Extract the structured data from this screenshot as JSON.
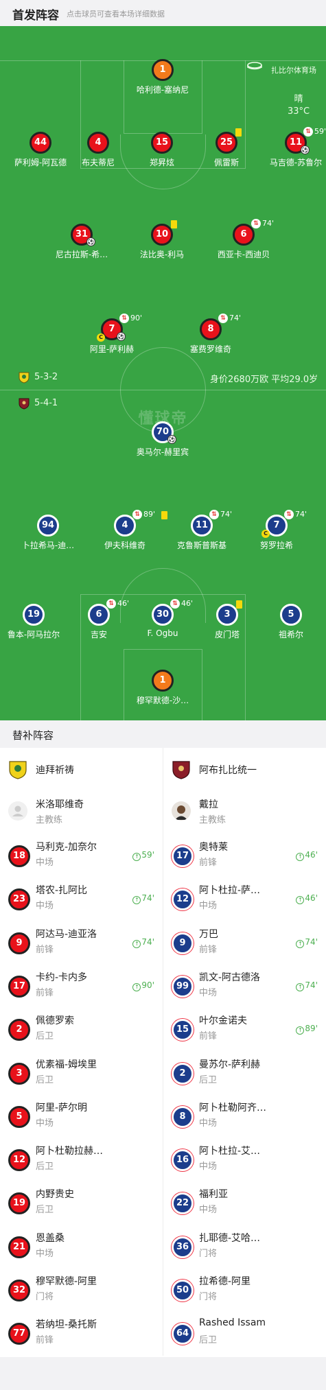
{
  "header": {
    "title": "首发阵容",
    "subtitle": "点击球员可查看本场详细数据"
  },
  "venue": {
    "name": "扎比尔体育场",
    "icon": "stadium-icon"
  },
  "weather": {
    "condition": "晴",
    "temp": "33°C"
  },
  "watermark": "懂球帝",
  "home_team": {
    "formation": "5-3-2",
    "value_text": "身价2680万欧 平均29.0岁"
  },
  "away_team": {
    "formation": "5-4-1"
  },
  "colors": {
    "pitch": "#38a444",
    "home": "#e8121b",
    "away": "#1c3d8c",
    "gk": "#f37a1c"
  },
  "lineup": [
    {
      "num": "1",
      "name": "哈利德-塞纳尼",
      "side": "home",
      "gk": true
    },
    {
      "num": "44",
      "name": "萨利姆-阿瓦德",
      "side": "home"
    },
    {
      "num": "4",
      "name": "布夫蒂尼",
      "side": "home"
    },
    {
      "num": "15",
      "name": "郑昇炫",
      "side": "home"
    },
    {
      "num": "25",
      "name": "佩雷斯",
      "side": "home",
      "yellow": true
    },
    {
      "num": "11",
      "name": "马吉德-苏鲁尔",
      "side": "home",
      "sub": "59'",
      "ball": true
    },
    {
      "num": "31",
      "name": "尼古拉斯-希…",
      "side": "home",
      "ball": true
    },
    {
      "num": "10",
      "name": "法比奥-利马",
      "side": "home",
      "yellow": true
    },
    {
      "num": "6",
      "name": "西亚卡-西迪贝",
      "side": "home",
      "sub": "74'"
    },
    {
      "num": "7",
      "name": "阿里-萨利赫",
      "side": "home",
      "sub": "90'",
      "ball": true,
      "captain": "C"
    },
    {
      "num": "8",
      "name": "塞费罗维奇",
      "side": "home",
      "sub": "74'"
    },
    {
      "num": "70",
      "name": "奥马尔-赫里宾",
      "side": "away",
      "ball": true
    },
    {
      "num": "94",
      "name": "卜拉希马-迪…",
      "side": "away"
    },
    {
      "num": "4",
      "name": "伊夫科维奇",
      "side": "away",
      "sub": "89'"
    },
    {
      "num": "11",
      "name": "克鲁斯普斯基",
      "side": "away",
      "sub": "74'",
      "yellow": true
    },
    {
      "num": "7",
      "name": "努罗拉希",
      "side": "away",
      "sub": "74'",
      "captain": "C"
    },
    {
      "num": "19",
      "name": "鲁本-阿马拉尔",
      "side": "away"
    },
    {
      "num": "6",
      "name": "吉安",
      "side": "away",
      "sub": "46'"
    },
    {
      "num": "30",
      "name": "F. Ogbu",
      "side": "away",
      "sub": "46'"
    },
    {
      "num": "3",
      "name": "皮门塔",
      "side": "away",
      "yellow": true
    },
    {
      "num": "5",
      "name": "祖希尔",
      "side": "away"
    },
    {
      "num": "1",
      "name": "穆罕默德-沙…",
      "side": "away",
      "gk": true
    }
  ],
  "bench_title": "替补阵容",
  "bench_home": {
    "team": "迪拜祈祷",
    "coach": {
      "name": "米洛耶维奇",
      "role": "主教练"
    },
    "players": [
      {
        "num": "18",
        "name": "马利克-加奈尔",
        "pos": "中场",
        "sub": "59'"
      },
      {
        "num": "23",
        "name": "塔农-扎阿比",
        "pos": "中场",
        "sub": "74'"
      },
      {
        "num": "9",
        "name": "阿达马-迪亚洛",
        "pos": "前锋",
        "sub": "74'"
      },
      {
        "num": "17",
        "name": "卡约-卡内多",
        "pos": "前锋",
        "sub": "90'"
      },
      {
        "num": "2",
        "name": "佩德罗索",
        "pos": "后卫",
        "sub": ""
      },
      {
        "num": "3",
        "name": "优素福-姆埃里",
        "pos": "后卫",
        "sub": ""
      },
      {
        "num": "5",
        "name": "阿里-萨尔明",
        "pos": "中场",
        "sub": ""
      },
      {
        "num": "12",
        "name": "阿卜杜勒拉赫…",
        "pos": "后卫",
        "sub": ""
      },
      {
        "num": "19",
        "name": "内野贵史",
        "pos": "后卫",
        "sub": ""
      },
      {
        "num": "21",
        "name": "恩盖桑",
        "pos": "中场",
        "sub": ""
      },
      {
        "num": "32",
        "name": "穆罕默德-阿里",
        "pos": "门将",
        "sub": ""
      },
      {
        "num": "77",
        "name": "若纳坦-桑托斯",
        "pos": "前锋",
        "sub": ""
      }
    ]
  },
  "bench_away": {
    "team": "阿布扎比统一",
    "coach": {
      "name": "戴拉",
      "role": "主教练"
    },
    "players": [
      {
        "num": "17",
        "name": "奥特莱",
        "pos": "前锋",
        "sub": "46'"
      },
      {
        "num": "12",
        "name": "阿卜杜拉-萨…",
        "pos": "中场",
        "sub": "46'"
      },
      {
        "num": "9",
        "name": "万巴",
        "pos": "前锋",
        "sub": "74'"
      },
      {
        "num": "99",
        "name": "凯文-阿古德洛",
        "pos": "中场",
        "sub": "74'"
      },
      {
        "num": "15",
        "name": "叶尔金诺夫",
        "pos": "前锋",
        "sub": "89'"
      },
      {
        "num": "2",
        "name": "曼苏尔-萨利赫",
        "pos": "后卫",
        "sub": ""
      },
      {
        "num": "8",
        "name": "阿卜杜勒阿齐…",
        "pos": "中场",
        "sub": ""
      },
      {
        "num": "16",
        "name": "阿卜杜拉-艾…",
        "pos": "中场",
        "sub": ""
      },
      {
        "num": "22",
        "name": "福利亚",
        "pos": "中场",
        "sub": ""
      },
      {
        "num": "36",
        "name": "扎耶德-艾哈…",
        "pos": "门将",
        "sub": ""
      },
      {
        "num": "50",
        "name": "拉希德-阿里",
        "pos": "门将",
        "sub": ""
      },
      {
        "num": "64",
        "name": "Rashed Issam",
        "pos": "后卫",
        "sub": ""
      }
    ]
  }
}
